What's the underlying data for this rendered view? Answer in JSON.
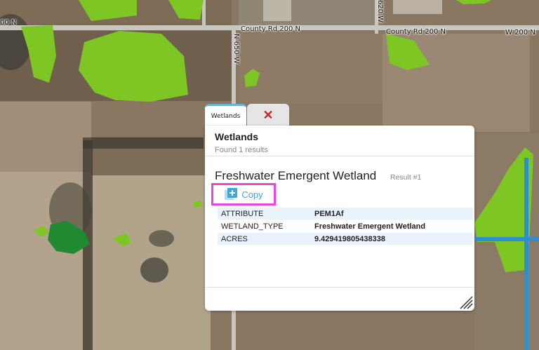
{
  "map": {
    "road_labels": {
      "county_rd_left": "County Rd 200 N",
      "county_rd_right": "County Rd 200 N",
      "w200n_right": "W 200 N",
      "left_edge": "00 N",
      "n650w": "N 650 W",
      "n620w": "620 W"
    },
    "colors": {
      "wetland": "#7ec624",
      "forested": "#1f8a2f",
      "water": "#2b8fd0",
      "highlight": "#e846e0",
      "accent": "#3fa6d9"
    }
  },
  "popup": {
    "tabs": {
      "active_label": "Wetlands",
      "close_icon": "close-icon"
    },
    "layer_title": "Wetlands",
    "results_summary": "Found 1 results",
    "feature_title": "Freshwater Emergent Wetland",
    "result_label": "Result #1",
    "copy_label": "Copy",
    "attributes": [
      {
        "key": "ATTRIBUTE",
        "value": "PEM1Af"
      },
      {
        "key": "WETLAND_TYPE",
        "value": "Freshwater Emergent Wetland"
      },
      {
        "key": "ACRES",
        "value": "9.429419805438338"
      }
    ]
  }
}
